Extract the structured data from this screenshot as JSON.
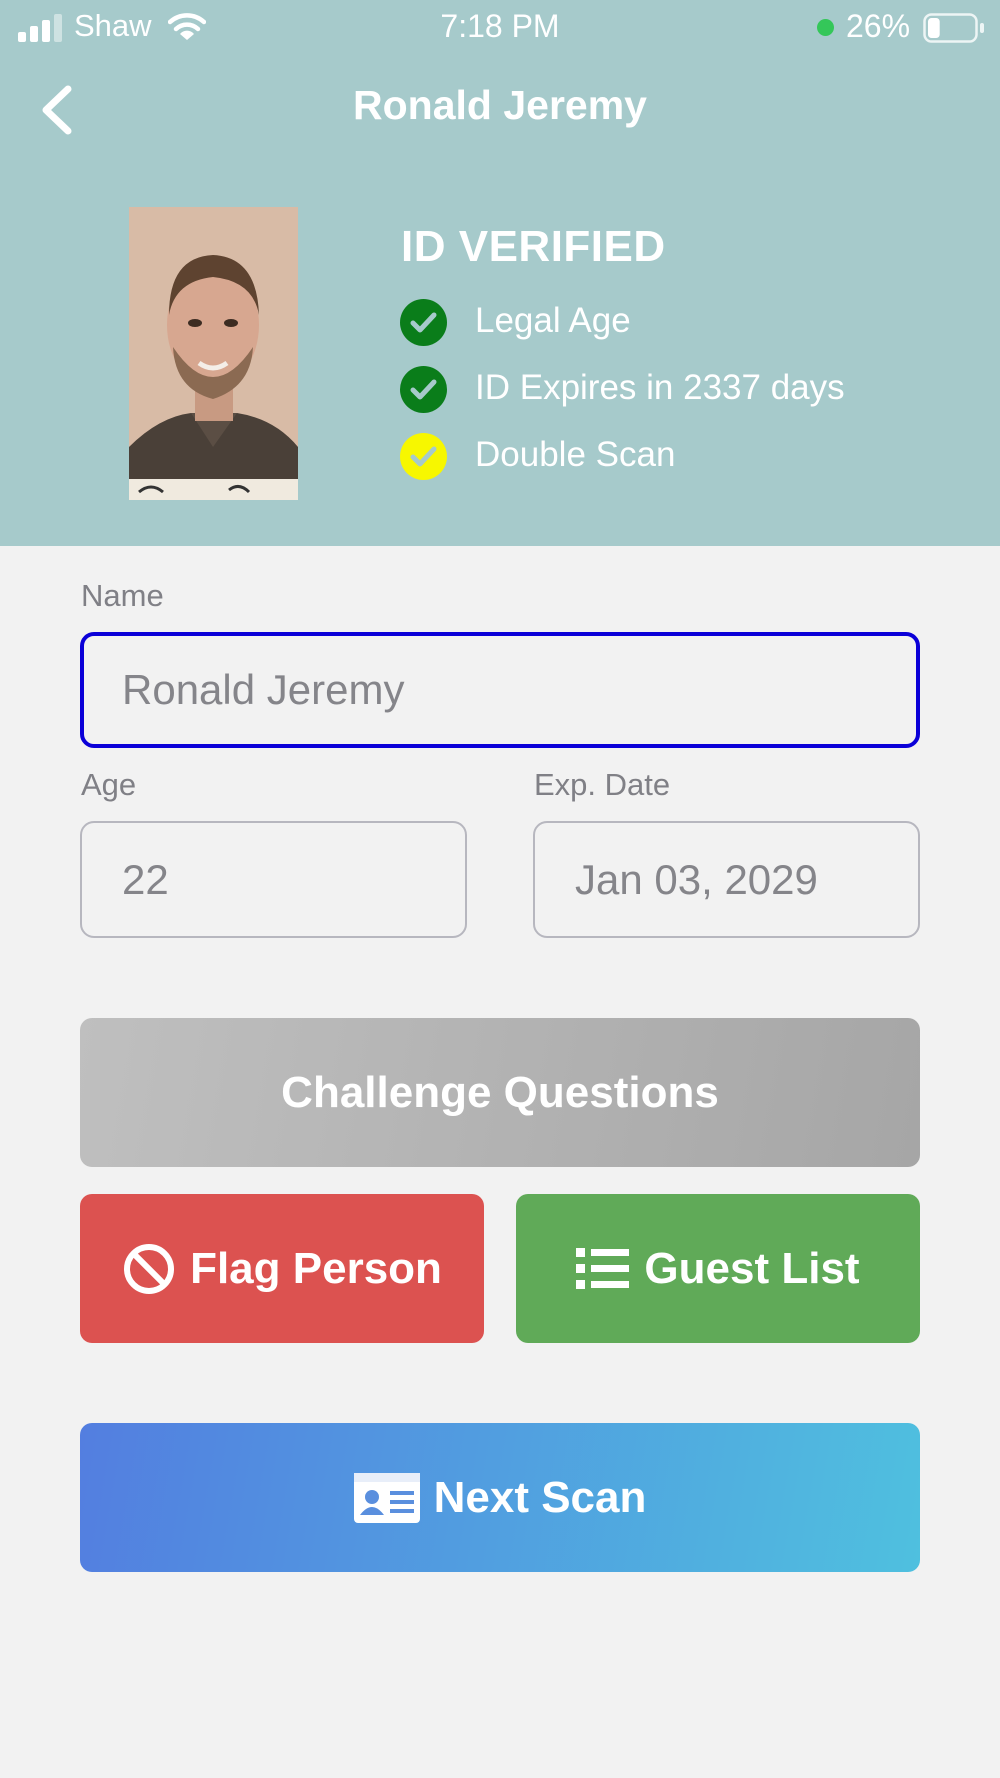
{
  "status_bar": {
    "carrier": "Shaw",
    "time": "7:18 PM",
    "battery_percent": "26%",
    "battery_level": 0.26
  },
  "header": {
    "title": "Ronald Jeremy",
    "back_icon": "chevron-left-icon",
    "bg_color": "#a6cacb"
  },
  "verification": {
    "status": "ID VERIFIED",
    "checks": [
      {
        "label": "Legal Age",
        "color": "#0a7d1a",
        "icon": "check-icon"
      },
      {
        "label": "ID Expires in 2337 days",
        "color": "#0a7d1a",
        "icon": "check-icon"
      },
      {
        "label": "Double Scan",
        "color": "#f7f700",
        "icon": "check-icon"
      }
    ]
  },
  "form": {
    "name": {
      "label": "Name",
      "value": "Ronald Jeremy"
    },
    "age": {
      "label": "Age",
      "value": "22"
    },
    "exp_date": {
      "label": "Exp. Date",
      "value": "Jan 03, 2029"
    }
  },
  "buttons": {
    "challenge": "Challenge Questions",
    "flag": "Flag Person",
    "guest_list": "Guest List",
    "next_scan": "Next Scan"
  },
  "colors": {
    "flag": "#dc5250",
    "guest_list": "#60aa58",
    "active_field_border": "#0b00d8"
  }
}
